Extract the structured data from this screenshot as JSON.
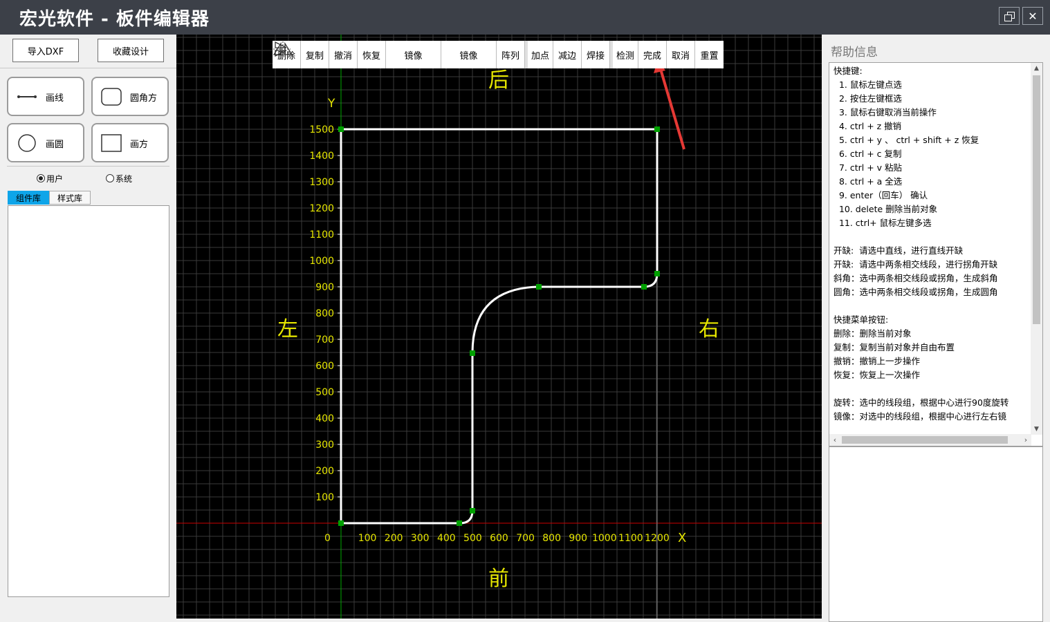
{
  "window": {
    "title": "宏光软件 - 板件编辑器",
    "restore_icon": "restore-icon",
    "close_icon": "close-icon",
    "close_glyph": "✕"
  },
  "left": {
    "import_label": "导入DXF",
    "favorite_label": "收藏设计",
    "tools": [
      {
        "label": "画线",
        "icon": "line-icon"
      },
      {
        "label": "圆角方",
        "icon": "rounded-rect-icon"
      },
      {
        "label": "画圆",
        "icon": "circle-icon"
      },
      {
        "label": "画方",
        "icon": "rect-icon"
      }
    ],
    "radio_user": "用户",
    "radio_system": "系统",
    "radio_selected": "用户",
    "tab_components": "组件库",
    "tab_styles": "样式库",
    "active_tab": "组件库"
  },
  "toolbar": {
    "delete": "删除",
    "copy": "复制",
    "undo": "撤消",
    "redo": "恢复",
    "mirror_v": "镜像",
    "mirror_h": "镜像",
    "array": "阵列",
    "add_point": "加点",
    "reduce_edge": "减边",
    "weld": "焊接",
    "check": "检测",
    "finish": "完成",
    "cancel": "取消",
    "reset": "重置"
  },
  "canvas": {
    "side_back": "后",
    "side_front": "前",
    "side_left": "左",
    "side_right": "右",
    "axis_x": "X",
    "axis_y": "Y",
    "origin": "0",
    "x_ticks": [
      "100",
      "200",
      "300",
      "400",
      "500",
      "600",
      "700",
      "800",
      "900",
      "1000",
      "1100",
      "1200"
    ],
    "y_ticks": [
      "100",
      "200",
      "300",
      "400",
      "500",
      "600",
      "700",
      "800",
      "900",
      "1000",
      "1100",
      "1200",
      "1300",
      "1400",
      "1500"
    ],
    "colors": {
      "background": "#000000",
      "grid": "#3a3a3a",
      "axis_x": "#cc0000",
      "axis_y": "#00aa00",
      "labels": "#e6e600",
      "shape": "#ffffff",
      "handle": "#00a000",
      "annotation_arrow": "#e53935"
    }
  },
  "help": {
    "title": "帮助信息",
    "lines": [
      "快捷键:",
      "  1. 鼠标左键点选",
      "  2. 按住左键框选",
      "  3. 鼠标右键取消当前操作",
      "  4. ctrl + z 撤销",
      "  5. ctrl + y 、 ctrl + shift + z 恢复",
      "  6. ctrl + c 复制",
      "  7. ctrl + v 粘贴",
      "  8. ctrl + a 全选",
      "  9. enter（回车） 确认",
      "  10. delete 删除当前对象",
      "  11. ctrl+ 鼠标左键多选",
      "",
      "开缺:  请选中直线，进行直线开缺",
      "开缺:  请选中两条相交线段，进行拐角开缺",
      "斜角：选中两条相交线段或拐角，生成斜角",
      "圆角：选中两条相交线段或拐角，生成圆角",
      "",
      "快捷菜单按钮:",
      "删除：删除当前对象",
      "复制：复制当前对象并自由布置",
      "撤销：撤销上一步操作",
      "恢复：恢复上一次操作",
      "",
      "旋转：选中的线段组，根据中心进行90度旋转",
      "镜像：对选中的线段组，根据中心进行左右镜"
    ]
  }
}
